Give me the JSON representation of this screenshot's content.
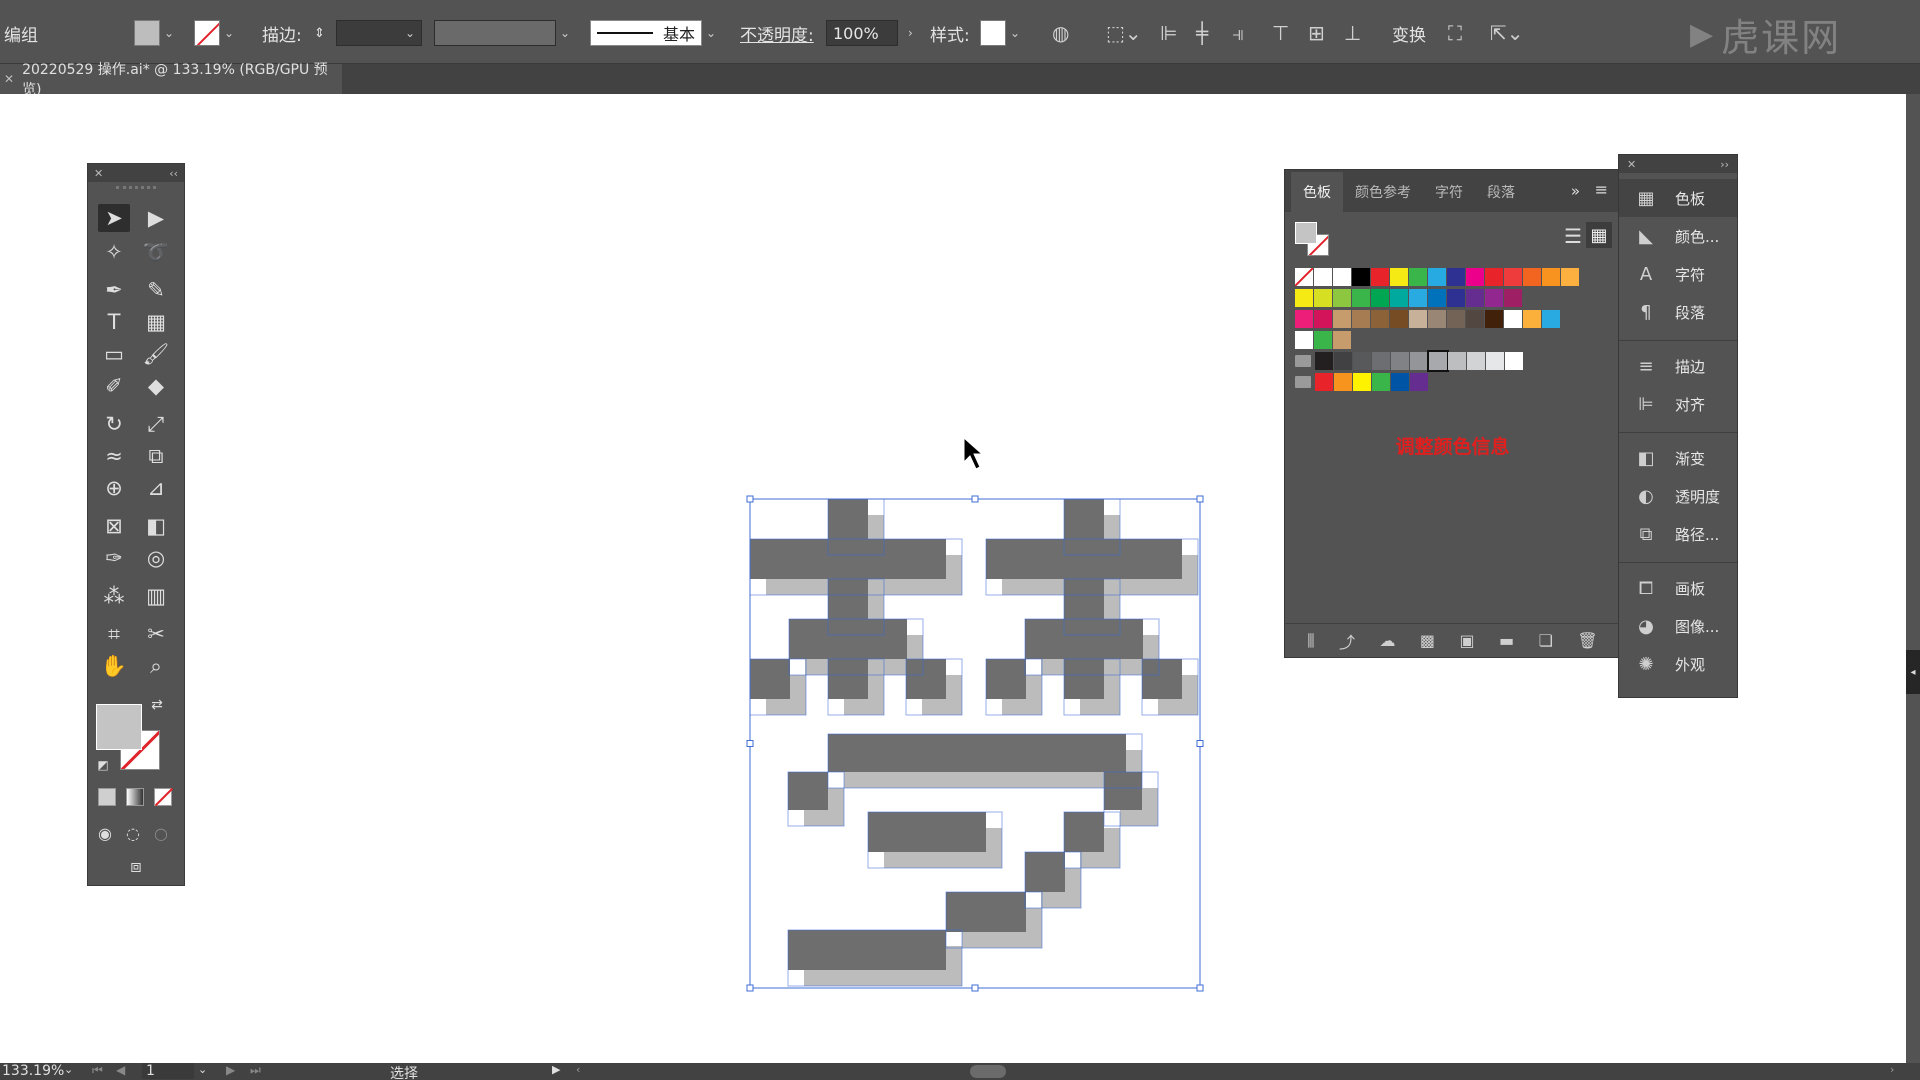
{
  "app": {
    "watermark": "虎课网"
  },
  "control_bar": {
    "selection_type": "编组",
    "stroke_label": "描边:",
    "stroke_profile": "基本",
    "opacity_label": "不透明度:",
    "opacity_value": "100%",
    "style_label": "样式:",
    "transform_label": "变换"
  },
  "document_tab": {
    "title": "20220529 操作.ai* @ 133.19% (RGB/GPU 预览)"
  },
  "swatches_panel": {
    "tabs": [
      "色板",
      "颜色参考",
      "字符",
      "段落"
    ],
    "annotation": "调整颜色信息",
    "rows": [
      [
        "#ffffff",
        "#ffffff",
        "#ffffff",
        "#000000",
        "#e8232a",
        "#f5ea14",
        "#3ab54a",
        "#27a9e1",
        "#2e3092",
        "#ec008b",
        "#e8232a",
        "#ee3b3b",
        "#f16521",
        "#f7931e",
        "#fbb040"
      ],
      [
        "#f5ea14",
        "#d7df23",
        "#8dc63f",
        "#39b54a",
        "#00a651",
        "#00a99d",
        "#29abe2",
        "#0072bc",
        "#2e3192",
        "#662d91",
        "#92278f",
        "#9e1f63"
      ],
      [
        "#ed1e79",
        "#d4145a",
        "#c69c6d",
        "#a67c52",
        "#8c6239",
        "#754c24",
        "#c7b299",
        "#998675",
        "#736357",
        "#534741",
        "#42210b",
        "#ffffff",
        "#fbb03b",
        "#29abe2"
      ],
      [
        "#ffffff",
        "#39b54a",
        "#c69c6d"
      ],
      [
        "#231f20",
        "#414042",
        "#58595b",
        "#6d6e71",
        "#808285",
        "#939598",
        "#a7a9ac",
        "#bcbec0",
        "#d1d3d4",
        "#e6e7e8",
        "#ffffff"
      ],
      [
        "#e8232a",
        "#f7941d",
        "#fff200",
        "#39b54a",
        "#0054a6",
        "#662d91"
      ]
    ]
  },
  "side_dock": {
    "items": [
      "色板",
      "颜色...",
      "字符",
      "段落",
      "描边",
      "对齐",
      "渐变",
      "透明度",
      "路径...",
      "画板",
      "图像...",
      "外观"
    ]
  },
  "status_bar": {
    "zoom": "133.19%",
    "artboard_number": "1",
    "tool_name": "选择"
  },
  "artwork": {
    "fill_color": "#6e6e6e",
    "shadow_color": "#bcbcbc",
    "selection_color": "#3d6cd6"
  }
}
